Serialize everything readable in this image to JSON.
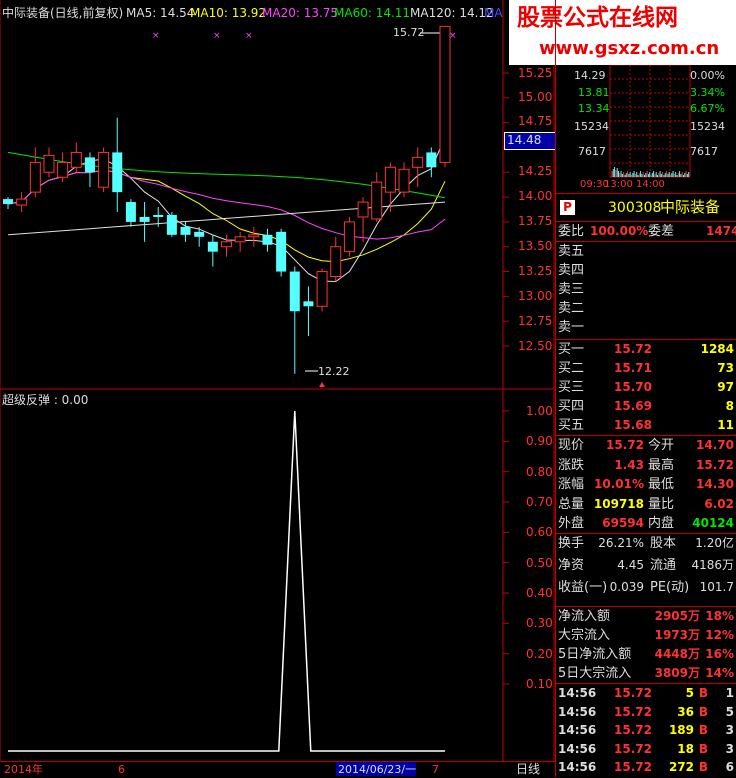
{
  "header": {
    "title": "中际装备(日线,前复权)",
    "ma5": "MA5: 14.54",
    "ma10": "MA10: 13.92",
    "ma20": "MA20: 13.75",
    "ma60": "MA60: 14.11",
    "ma120": "MA120: 14.12",
    "ma_extra": "MA"
  },
  "watermark": {
    "brand": "股票公式在线网",
    "url": "www.gsxz.com.cn"
  },
  "price_axis": [
    "15.25",
    "15.00",
    "14.75",
    "14.50",
    "14.25",
    "14.00",
    "13.75",
    "13.50",
    "13.25",
    "13.00",
    "12.75",
    "12.50"
  ],
  "price_marker": "14.48",
  "high_label": "15.72",
  "low_label": "12.22",
  "indicator": {
    "label": "超级反弹 : 0.00",
    "axis": [
      "1.00",
      "0.90",
      "0.80",
      "0.70",
      "0.60",
      "0.50",
      "0.40",
      "0.30",
      "0.20",
      "0.10"
    ]
  },
  "bottom_axis": {
    "year": "2014年",
    "m6": "6",
    "date": "2014/06/23/一",
    "m7": "7",
    "period": "日线"
  },
  "mini": {
    "left_labels": [
      "14.29",
      "13.81",
      "13.34",
      "15234",
      "7617"
    ],
    "right_labels": [
      "0.00%",
      "3.34%",
      "6.67%",
      "15234",
      "7617"
    ],
    "time_label": "09:30",
    "time_label2": "13:00",
    "time_label3": "14:00"
  },
  "stock": {
    "icon_letter": "P",
    "code": "300308",
    "name": "中际装备"
  },
  "order_book": {
    "weibi_label": "委比",
    "weibi_value": "100.00%",
    "weicha_label": "委差",
    "weicha_value": "1474",
    "sell": [
      "卖五",
      "卖四",
      "卖三",
      "卖二",
      "卖一"
    ],
    "buy": [
      {
        "label": "买一",
        "price": "15.72",
        "vol": "1284"
      },
      {
        "label": "买二",
        "price": "15.71",
        "vol": "73"
      },
      {
        "label": "买三",
        "price": "15.70",
        "vol": "97"
      },
      {
        "label": "买四",
        "price": "15.69",
        "vol": "8"
      },
      {
        "label": "买五",
        "price": "15.68",
        "vol": "11"
      }
    ]
  },
  "quote": [
    {
      "l1": "现价",
      "v1": "15.72",
      "l2": "今开",
      "v2": "14.70"
    },
    {
      "l1": "涨跌",
      "v1": "1.43",
      "l2": "最高",
      "v2": "15.72"
    },
    {
      "l1": "涨幅",
      "v1": "10.01%",
      "l2": "最低",
      "v2": "14.30"
    },
    {
      "l1": "总量",
      "v1": "109718",
      "l2": "量比",
      "v2": "6.02"
    },
    {
      "l1": "外盘",
      "v1": "69594",
      "l2": "内盘",
      "v2": "40124"
    }
  ],
  "fundamentals": [
    {
      "l1": "换手",
      "v1": "26.21%",
      "l2": "股本",
      "v2": "1.20亿"
    },
    {
      "l1": "净资",
      "v1": "4.45",
      "l2": "流通",
      "v2": "4186万"
    },
    {
      "l1": "收益(一)",
      "v1": "0.039",
      "l2": "PE(动)",
      "v2": "101.7"
    }
  ],
  "flows": [
    {
      "label": "净流入额",
      "value": "2905万",
      "pct": "18%"
    },
    {
      "label": "大宗流入",
      "value": "1973万",
      "pct": "12%"
    },
    {
      "label": "5日净流入额",
      "value": "4448万",
      "pct": "16%"
    },
    {
      "label": "5日大宗流入",
      "value": "3809万",
      "pct": "14%"
    }
  ],
  "ticks": [
    {
      "time": "14:56",
      "price": "15.72",
      "vol": "5",
      "side": "B",
      "extra": "1"
    },
    {
      "time": "14:56",
      "price": "15.72",
      "vol": "36",
      "side": "B",
      "extra": "5"
    },
    {
      "time": "14:56",
      "price": "15.72",
      "vol": "189",
      "side": "B",
      "extra": "3"
    },
    {
      "time": "14:56",
      "price": "15.72",
      "vol": "18",
      "side": "B",
      "extra": "3"
    },
    {
      "time": "14:56",
      "price": "15.72",
      "vol": "272",
      "side": "B",
      "extra": "6"
    }
  ],
  "chart_data": {
    "type": "candlestick",
    "price_range": [
      12.2,
      15.5
    ],
    "candles": [
      {
        "o": 13.98,
        "c": 13.93,
        "h": 14.0,
        "l": 13.88
      },
      {
        "o": 13.92,
        "c": 13.98,
        "h": 14.05,
        "l": 13.85
      },
      {
        "o": 14.05,
        "c": 14.35,
        "h": 14.5,
        "l": 14.0
      },
      {
        "o": 14.25,
        "c": 14.42,
        "h": 14.5,
        "l": 14.2
      },
      {
        "o": 14.2,
        "c": 14.35,
        "h": 14.45,
        "l": 14.15
      },
      {
        "o": 14.3,
        "c": 14.45,
        "h": 14.55,
        "l": 14.25
      },
      {
        "o": 14.4,
        "c": 14.25,
        "h": 14.45,
        "l": 14.1
      },
      {
        "o": 14.1,
        "c": 14.45,
        "h": 14.5,
        "l": 14.05
      },
      {
        "o": 14.45,
        "c": 14.05,
        "h": 14.8,
        "l": 13.85
      },
      {
        "o": 13.95,
        "c": 13.75,
        "h": 13.98,
        "l": 13.7
      },
      {
        "o": 13.8,
        "c": 13.75,
        "h": 13.95,
        "l": 13.55
      },
      {
        "o": 13.82,
        "c": 13.8,
        "h": 13.9,
        "l": 13.7
      },
      {
        "o": 13.82,
        "c": 13.62,
        "h": 13.85,
        "l": 13.6
      },
      {
        "o": 13.7,
        "c": 13.62,
        "h": 13.75,
        "l": 13.55
      },
      {
        "o": 13.65,
        "c": 13.6,
        "h": 13.7,
        "l": 13.5
      },
      {
        "o": 13.55,
        "c": 13.45,
        "h": 13.62,
        "l": 13.3
      },
      {
        "o": 13.5,
        "c": 13.55,
        "h": 13.62,
        "l": 13.4
      },
      {
        "o": 13.55,
        "c": 13.6,
        "h": 13.65,
        "l": 13.45
      },
      {
        "o": 13.6,
        "c": 13.62,
        "h": 13.7,
        "l": 13.5
      },
      {
        "o": 13.62,
        "c": 13.52,
        "h": 13.68,
        "l": 13.45
      },
      {
        "o": 13.65,
        "c": 13.25,
        "h": 13.68,
        "l": 13.2
      },
      {
        "o": 13.25,
        "c": 12.85,
        "h": 13.3,
        "l": 12.22
      },
      {
        "o": 12.95,
        "c": 12.9,
        "h": 13.1,
        "l": 12.6
      },
      {
        "o": 12.9,
        "c": 13.25,
        "h": 13.28,
        "l": 12.85
      },
      {
        "o": 13.2,
        "c": 13.5,
        "h": 13.6,
        "l": 13.15
      },
      {
        "o": 13.45,
        "c": 13.75,
        "h": 13.8,
        "l": 13.4
      },
      {
        "o": 13.8,
        "c": 13.95,
        "h": 14.0,
        "l": 13.55
      },
      {
        "o": 13.78,
        "c": 14.15,
        "h": 14.25,
        "l": 13.75
      },
      {
        "o": 14.05,
        "c": 14.3,
        "h": 14.35,
        "l": 13.85
      },
      {
        "o": 14.05,
        "c": 14.28,
        "h": 14.35,
        "l": 14.0
      },
      {
        "o": 14.3,
        "c": 14.4,
        "h": 14.5,
        "l": 14.1
      },
      {
        "o": 14.45,
        "c": 14.3,
        "h": 14.5,
        "l": 14.2
      },
      {
        "o": 14.35,
        "c": 15.72,
        "h": 15.72,
        "l": 14.3
      }
    ],
    "indicator_series": [
      0,
      0,
      0,
      0,
      0,
      0,
      0,
      0,
      0,
      0,
      0,
      0,
      0,
      0,
      0,
      0,
      0,
      0,
      0,
      0,
      0,
      1,
      0,
      0,
      0,
      0,
      0,
      0,
      0,
      0,
      0,
      0,
      0
    ],
    "indicator_range": [
      0,
      1
    ]
  }
}
